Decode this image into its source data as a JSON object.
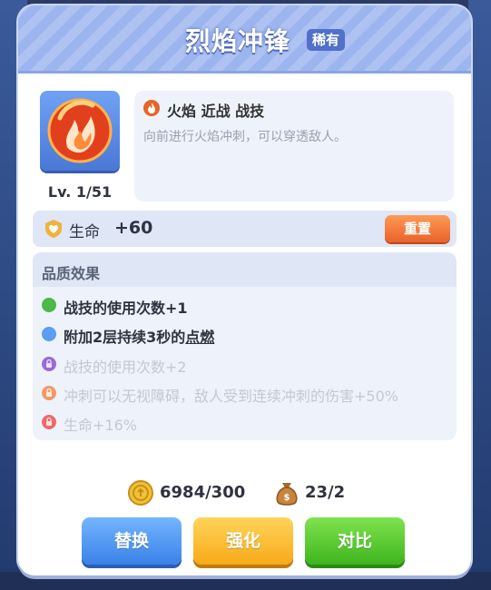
{
  "dialog": {
    "title": "烈焰冲锋",
    "rarity": "稀有"
  },
  "skill": {
    "level": "Lv. 1/51",
    "tags": "火焰 近战 战技",
    "description": "向前进行火焰冲刺，可以穿透敌人。"
  },
  "stat": {
    "label": "生命",
    "value": "+60",
    "reset_label": "重置"
  },
  "quality": {
    "title": "品质效果",
    "effects": [
      {
        "text": "战技的使用次数+1",
        "state": "active",
        "color": "#4cb84a"
      },
      {
        "text_before": "附加2层持续3秒的",
        "text_link": "点燃",
        "state": "active",
        "color": "#5b9df0"
      },
      {
        "text": "战技的使用次数+2",
        "state": "locked",
        "color": "#9a6ad8"
      },
      {
        "text": "冲刺可以无视障碍，敌人受到连续冲刺的伤害+50%",
        "state": "locked",
        "color": "#f09a6a"
      },
      {
        "text": "生命+16%",
        "state": "locked",
        "color": "#ee6a6a"
      }
    ]
  },
  "resources": {
    "coins": "6984/300",
    "bag": "23/2"
  },
  "buttons": {
    "replace": "替换",
    "upgrade": "强化",
    "compare": "对比"
  },
  "colors": {
    "header": "#9db5ef",
    "rarity_badge": "#5170c9",
    "reset": "#e8632a",
    "replace": "#3a82e8",
    "upgrade": "#f7aa19",
    "compare": "#3fb51f"
  }
}
